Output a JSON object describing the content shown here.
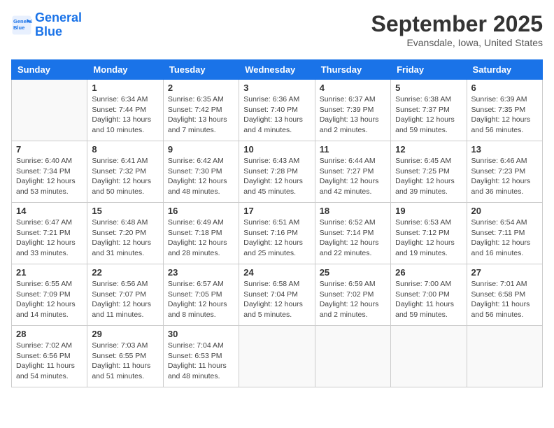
{
  "header": {
    "logo_line1": "General",
    "logo_line2": "Blue",
    "month_title": "September 2025",
    "location": "Evansdale, Iowa, United States"
  },
  "days_of_week": [
    "Sunday",
    "Monday",
    "Tuesday",
    "Wednesday",
    "Thursday",
    "Friday",
    "Saturday"
  ],
  "weeks": [
    [
      {
        "day": "",
        "info": ""
      },
      {
        "day": "1",
        "info": "Sunrise: 6:34 AM\nSunset: 7:44 PM\nDaylight: 13 hours\nand 10 minutes."
      },
      {
        "day": "2",
        "info": "Sunrise: 6:35 AM\nSunset: 7:42 PM\nDaylight: 13 hours\nand 7 minutes."
      },
      {
        "day": "3",
        "info": "Sunrise: 6:36 AM\nSunset: 7:40 PM\nDaylight: 13 hours\nand 4 minutes."
      },
      {
        "day": "4",
        "info": "Sunrise: 6:37 AM\nSunset: 7:39 PM\nDaylight: 13 hours\nand 2 minutes."
      },
      {
        "day": "5",
        "info": "Sunrise: 6:38 AM\nSunset: 7:37 PM\nDaylight: 12 hours\nand 59 minutes."
      },
      {
        "day": "6",
        "info": "Sunrise: 6:39 AM\nSunset: 7:35 PM\nDaylight: 12 hours\nand 56 minutes."
      }
    ],
    [
      {
        "day": "7",
        "info": "Sunrise: 6:40 AM\nSunset: 7:34 PM\nDaylight: 12 hours\nand 53 minutes."
      },
      {
        "day": "8",
        "info": "Sunrise: 6:41 AM\nSunset: 7:32 PM\nDaylight: 12 hours\nand 50 minutes."
      },
      {
        "day": "9",
        "info": "Sunrise: 6:42 AM\nSunset: 7:30 PM\nDaylight: 12 hours\nand 48 minutes."
      },
      {
        "day": "10",
        "info": "Sunrise: 6:43 AM\nSunset: 7:28 PM\nDaylight: 12 hours\nand 45 minutes."
      },
      {
        "day": "11",
        "info": "Sunrise: 6:44 AM\nSunset: 7:27 PM\nDaylight: 12 hours\nand 42 minutes."
      },
      {
        "day": "12",
        "info": "Sunrise: 6:45 AM\nSunset: 7:25 PM\nDaylight: 12 hours\nand 39 minutes."
      },
      {
        "day": "13",
        "info": "Sunrise: 6:46 AM\nSunset: 7:23 PM\nDaylight: 12 hours\nand 36 minutes."
      }
    ],
    [
      {
        "day": "14",
        "info": "Sunrise: 6:47 AM\nSunset: 7:21 PM\nDaylight: 12 hours\nand 33 minutes."
      },
      {
        "day": "15",
        "info": "Sunrise: 6:48 AM\nSunset: 7:20 PM\nDaylight: 12 hours\nand 31 minutes."
      },
      {
        "day": "16",
        "info": "Sunrise: 6:49 AM\nSunset: 7:18 PM\nDaylight: 12 hours\nand 28 minutes."
      },
      {
        "day": "17",
        "info": "Sunrise: 6:51 AM\nSunset: 7:16 PM\nDaylight: 12 hours\nand 25 minutes."
      },
      {
        "day": "18",
        "info": "Sunrise: 6:52 AM\nSunset: 7:14 PM\nDaylight: 12 hours\nand 22 minutes."
      },
      {
        "day": "19",
        "info": "Sunrise: 6:53 AM\nSunset: 7:12 PM\nDaylight: 12 hours\nand 19 minutes."
      },
      {
        "day": "20",
        "info": "Sunrise: 6:54 AM\nSunset: 7:11 PM\nDaylight: 12 hours\nand 16 minutes."
      }
    ],
    [
      {
        "day": "21",
        "info": "Sunrise: 6:55 AM\nSunset: 7:09 PM\nDaylight: 12 hours\nand 14 minutes."
      },
      {
        "day": "22",
        "info": "Sunrise: 6:56 AM\nSunset: 7:07 PM\nDaylight: 12 hours\nand 11 minutes."
      },
      {
        "day": "23",
        "info": "Sunrise: 6:57 AM\nSunset: 7:05 PM\nDaylight: 12 hours\nand 8 minutes."
      },
      {
        "day": "24",
        "info": "Sunrise: 6:58 AM\nSunset: 7:04 PM\nDaylight: 12 hours\nand 5 minutes."
      },
      {
        "day": "25",
        "info": "Sunrise: 6:59 AM\nSunset: 7:02 PM\nDaylight: 12 hours\nand 2 minutes."
      },
      {
        "day": "26",
        "info": "Sunrise: 7:00 AM\nSunset: 7:00 PM\nDaylight: 11 hours\nand 59 minutes."
      },
      {
        "day": "27",
        "info": "Sunrise: 7:01 AM\nSunset: 6:58 PM\nDaylight: 11 hours\nand 56 minutes."
      }
    ],
    [
      {
        "day": "28",
        "info": "Sunrise: 7:02 AM\nSunset: 6:56 PM\nDaylight: 11 hours\nand 54 minutes."
      },
      {
        "day": "29",
        "info": "Sunrise: 7:03 AM\nSunset: 6:55 PM\nDaylight: 11 hours\nand 51 minutes."
      },
      {
        "day": "30",
        "info": "Sunrise: 7:04 AM\nSunset: 6:53 PM\nDaylight: 11 hours\nand 48 minutes."
      },
      {
        "day": "",
        "info": ""
      },
      {
        "day": "",
        "info": ""
      },
      {
        "day": "",
        "info": ""
      },
      {
        "day": "",
        "info": ""
      }
    ]
  ]
}
